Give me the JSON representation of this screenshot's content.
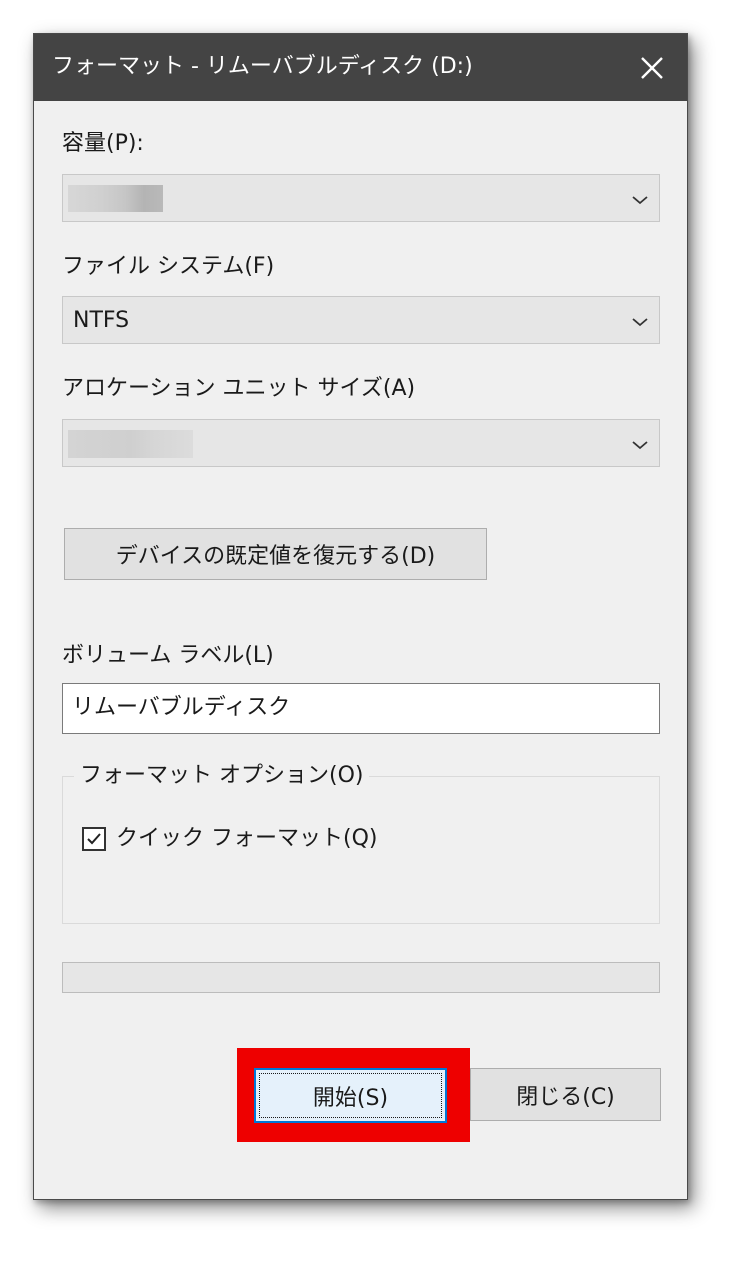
{
  "window": {
    "title": "フォーマット - リムーバブルディスク (D:)"
  },
  "capacity": {
    "label": "容量(P):",
    "value": ""
  },
  "file_system": {
    "label": "ファイル システム(F)",
    "value": "NTFS"
  },
  "allocation_unit": {
    "label": "アロケーション ユニット サイズ(A)",
    "value": ""
  },
  "restore_defaults_label": "デバイスの既定値を復元する(D)",
  "volume_label": {
    "label": "ボリューム ラベル(L)",
    "value": "リムーバブルディスク"
  },
  "format_options": {
    "legend": "フォーマット オプション(O)",
    "quick_format": {
      "label": "クイック フォーマット(Q)",
      "checked": true
    }
  },
  "progress": {
    "fraction": 0
  },
  "buttons": {
    "start": "開始(S)",
    "close": "閉じる(C)"
  },
  "colors": {
    "titlebar": "#444444",
    "dialog_background": "#f0f0f0",
    "highlight_box": "#ee0000",
    "focus_border": "#0078d7"
  },
  "icons": {
    "close": "close-icon",
    "dropdown": "chevron-down-icon",
    "check": "checkmark-icon"
  }
}
